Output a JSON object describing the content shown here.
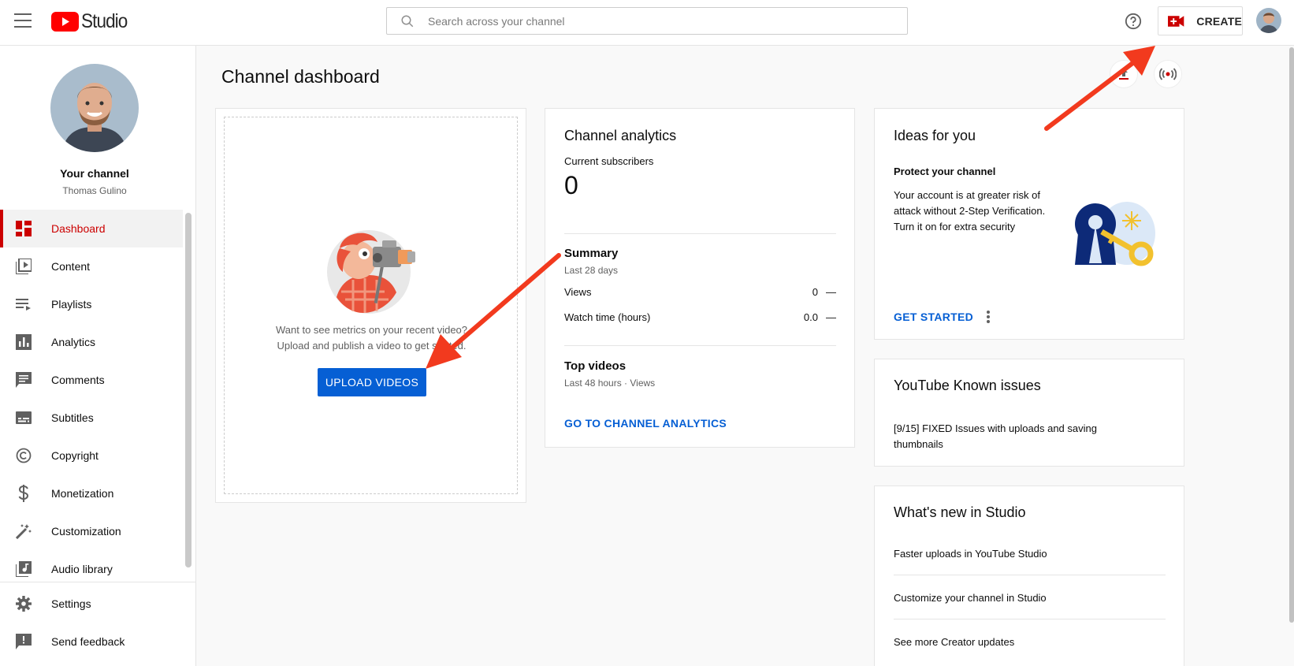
{
  "topbar": {
    "logo_text": "Studio",
    "search_placeholder": "Search across your channel",
    "create_label": "CREATE"
  },
  "sidebar": {
    "channel_title": "Your channel",
    "channel_name": "Thomas Gulino",
    "items": [
      {
        "label": "Dashboard",
        "icon": "dashboard-icon",
        "active": true
      },
      {
        "label": "Content",
        "icon": "content-icon"
      },
      {
        "label": "Playlists",
        "icon": "playlists-icon"
      },
      {
        "label": "Analytics",
        "icon": "analytics-icon"
      },
      {
        "label": "Comments",
        "icon": "comments-icon"
      },
      {
        "label": "Subtitles",
        "icon": "subtitles-icon"
      },
      {
        "label": "Copyright",
        "icon": "copyright-icon"
      },
      {
        "label": "Monetization",
        "icon": "monetization-icon"
      },
      {
        "label": "Customization",
        "icon": "customization-icon"
      },
      {
        "label": "Audio library",
        "icon": "audio-library-icon"
      }
    ],
    "bottom_items": [
      {
        "label": "Settings",
        "icon": "settings-icon"
      },
      {
        "label": "Send feedback",
        "icon": "feedback-icon"
      }
    ]
  },
  "main": {
    "page_title": "Channel dashboard",
    "upload": {
      "line1": "Want to see metrics on your recent video?",
      "line2": "Upload and publish a video to get started.",
      "button": "UPLOAD VIDEOS"
    },
    "analytics": {
      "title": "Channel analytics",
      "subs_label": "Current subscribers",
      "subs_value": "0",
      "summary_title": "Summary",
      "summary_period": "Last 28 days",
      "metrics": [
        {
          "label": "Views",
          "value": "0",
          "trend": "—"
        },
        {
          "label": "Watch time (hours)",
          "value": "0.0",
          "trend": "—"
        }
      ],
      "top_videos_title": "Top videos",
      "top_videos_period": "Last 48 hours · Views",
      "link": "GO TO CHANNEL ANALYTICS"
    },
    "ideas": {
      "title": "Ideas for you",
      "subtitle": "Protect your channel",
      "body": "Your account is at greater risk of attack without 2-Step Verification. Turn it on for extra security",
      "link": "GET STARTED"
    },
    "issues": {
      "title": "YouTube Known issues",
      "body": "[9/15] FIXED Issues with uploads and saving thumbnails"
    },
    "news": {
      "title": "What's new in Studio",
      "items": [
        "Faster uploads in YouTube Studio",
        "Customize your channel in Studio",
        "See more Creator updates"
      ]
    }
  },
  "colors": {
    "brand_red": "#ff0000",
    "active_red": "#cc0000",
    "link_blue": "#065fd4",
    "annotation_arrow": "#f23a1e"
  }
}
